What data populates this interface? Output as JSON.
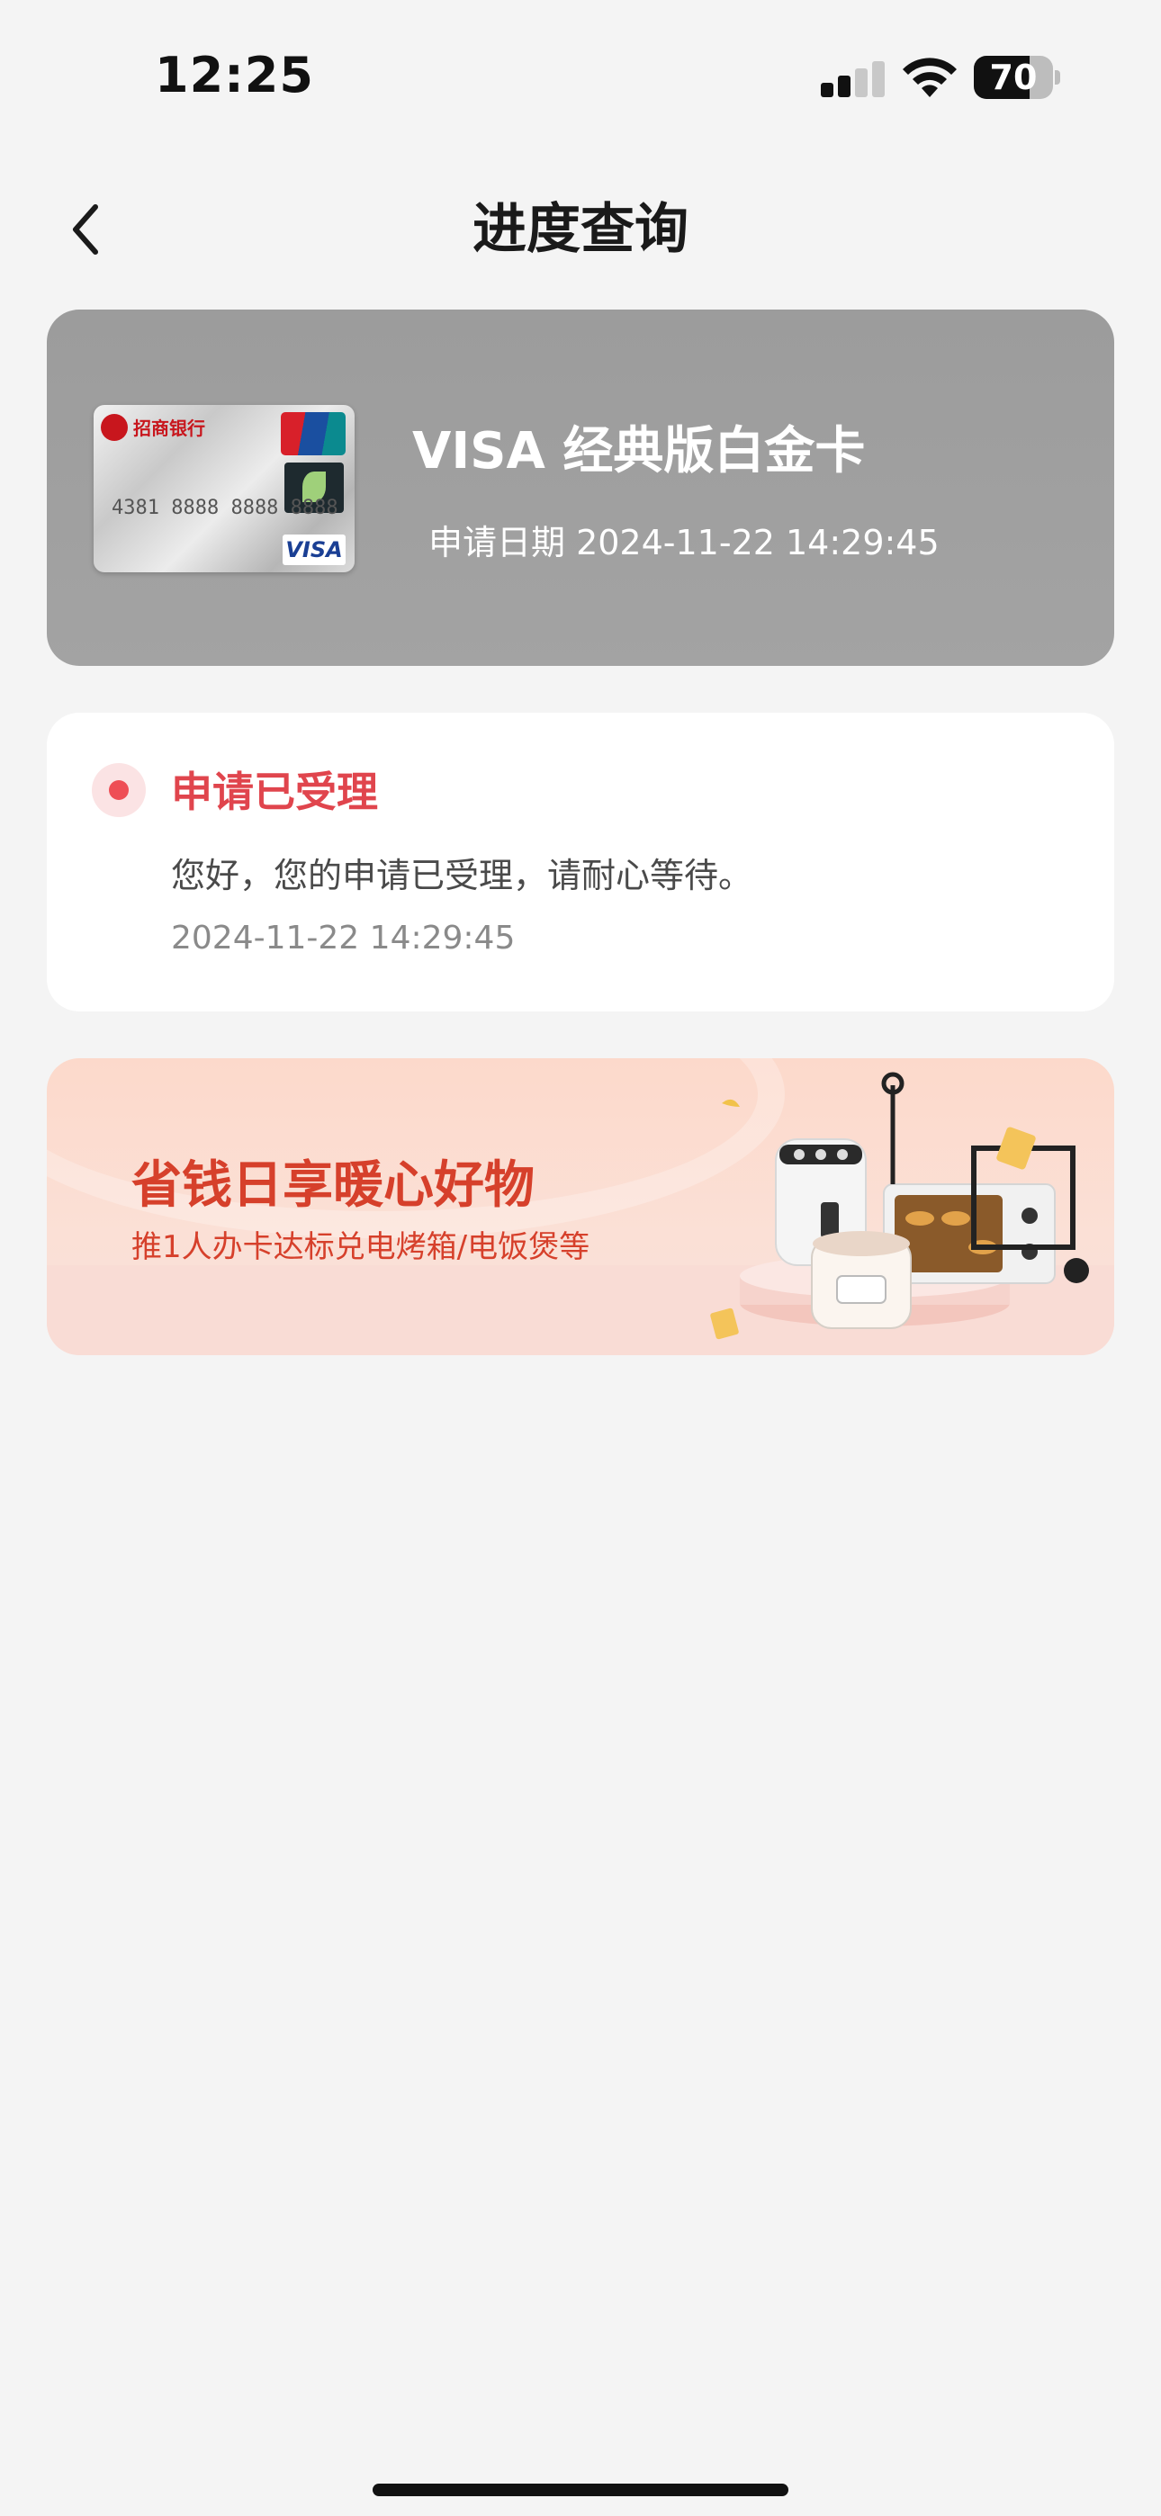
{
  "status_bar": {
    "time": "12:25",
    "battery_level": 70,
    "battery_label": "70"
  },
  "nav": {
    "title": "进度查询"
  },
  "card": {
    "name": "VISA 经典版白金卡",
    "apply_date_label": "申请日期 2024-11-22 14:29:45",
    "image": {
      "bank_name": "招商银行",
      "network": "VISA",
      "number_preview": "4381 8888 8888 8888"
    }
  },
  "status": {
    "title": "申请已受理",
    "message": "您好，您的申请已受理，请耐心等待。",
    "timestamp": "2024-11-22 14:29:45"
  },
  "promo": {
    "title": "省钱日享暖心好物",
    "subtitle": "推1人办卡达标兑电烤箱/电饭煲等"
  },
  "colors": {
    "accent_red": "#e0454d",
    "background": "#f4f4f4",
    "card_header_gray": "#9f9f9f",
    "promo_text": "#d6402b"
  }
}
